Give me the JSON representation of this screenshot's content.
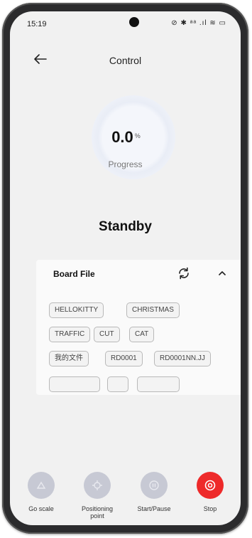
{
  "status_bar": {
    "time": "15:19",
    "icons_text": "⊘ ✱ ᵃᵃ .ıl ≋ ▭"
  },
  "header": {
    "title": "Control"
  },
  "progress": {
    "value": "0.0",
    "unit": "%",
    "label": "Progress"
  },
  "state": "Standby",
  "board_file": {
    "title": "Board File",
    "chips": [
      "HELLOKITTY",
      "CHRISTMAS",
      "TRAFFIC",
      "CUT",
      "CAT",
      "我的文件",
      "RD0001",
      "RD0001NN.JJ"
    ]
  },
  "actions": [
    {
      "label": "Go scale",
      "icon": "scale-icon",
      "color": "#c7c9d4"
    },
    {
      "label": "Positioning point",
      "icon": "positioning-icon",
      "color": "#c7c9d4"
    },
    {
      "label": "Start/Pause",
      "icon": "play-pause-icon",
      "color": "#c7c9d4"
    },
    {
      "label": "Stop",
      "icon": "stop-icon",
      "color": "#ee2a2a"
    }
  ]
}
